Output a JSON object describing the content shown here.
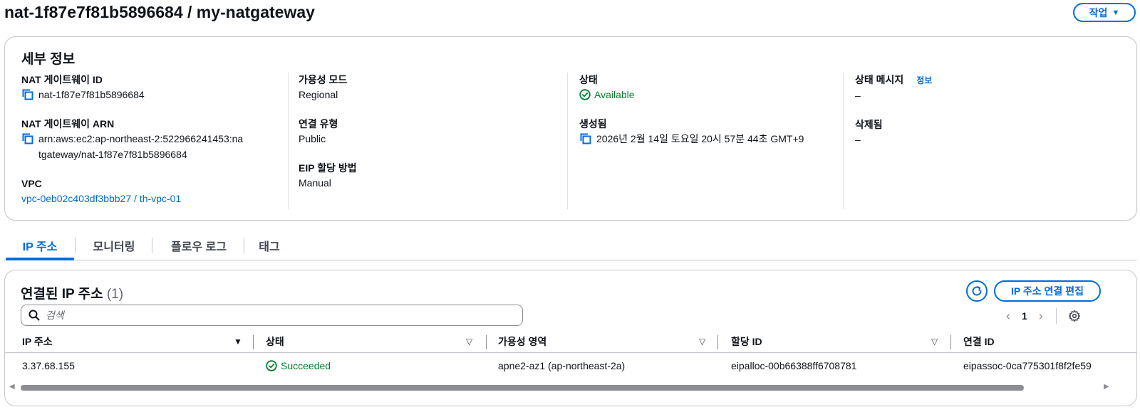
{
  "header": {
    "title": "nat-1f87e7f81b5896684 / my-natgateway",
    "actions_label": "작업"
  },
  "details": {
    "title": "세부 정보",
    "nat_id_label": "NAT 게이트웨이 ID",
    "nat_id_value": "nat-1f87e7f81b5896684",
    "nat_arn_label": "NAT 게이트웨이 ARN",
    "nat_arn_value_line1": "arn:aws:ec2:ap-northeast-2:522966241453:na",
    "nat_arn_value_line2": "tgateway/nat-1f87e7f81b5896684",
    "vpc_label": "VPC",
    "vpc_value": "vpc-0eb02c403df3bbb27 / th-vpc-01",
    "availability_mode_label": "가용성 모드",
    "availability_mode_value": "Regional",
    "connectivity_label": "연결 유형",
    "connectivity_value": "Public",
    "eip_method_label": "EIP 할당 방법",
    "eip_method_value": "Manual",
    "state_label": "상태",
    "state_value": "Available",
    "created_label": "생성됨",
    "created_value": "2026년 2월 14일 토요일 20시 57분 44초 GMT+9",
    "state_message_label": "상태 메시지",
    "info_link": "정보",
    "state_message_value": "–",
    "deleted_label": "삭제됨",
    "deleted_value": "–"
  },
  "tabs": [
    {
      "label": "IP 주소",
      "active": true
    },
    {
      "label": "모니터링",
      "active": false
    },
    {
      "label": "플로우 로그",
      "active": false
    },
    {
      "label": "태그",
      "active": false
    }
  ],
  "ip_panel": {
    "title": "연결된 IP 주소",
    "count": "(1)",
    "edit_label": "IP 주소 연결 편집",
    "search_placeholder": "검색",
    "page": "1",
    "columns": [
      "IP 주소",
      "상태",
      "가용성 영역",
      "할당 ID",
      "연결 ID"
    ],
    "rows": [
      {
        "ip": "3.37.68.155",
        "status": "Succeeded",
        "az": "apne2-az1 (ap-northeast-2a)",
        "allocation_id": "eipalloc-00b66388ff6708781",
        "association_id": "eipassoc-0ca775301f8f2fe59"
      }
    ]
  },
  "colors": {
    "primary": "#006ce0",
    "success": "#00802f",
    "text": "#0f141a",
    "border": "#c6c6cd"
  },
  "icons": [
    "copy-icon",
    "check-circle-icon",
    "refresh-icon",
    "search-icon",
    "gear-icon",
    "chevron-left-icon",
    "chevron-right-icon",
    "caret-down-icon",
    "sort-down-icon"
  ]
}
